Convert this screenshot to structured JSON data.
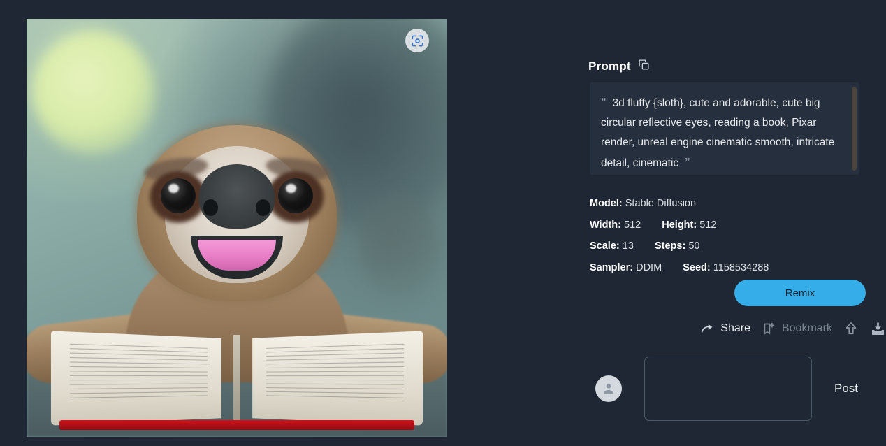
{
  "theme": {
    "background": "#1e2733",
    "panel": "#252f3d",
    "accent": "#34ade9",
    "text": "#e8eaec",
    "muted": "#7e8895"
  },
  "image": {
    "alt_description": "3d fluffy sloth reading a book",
    "scan_button_icon": "scan-viewfinder-icon"
  },
  "prompt": {
    "label": "Prompt",
    "copy_icon": "copy-icon",
    "quote_open": "“",
    "quote_close": "”",
    "text": "3d fluffy {sloth}, cute and adorable, cute big circular reflective eyes, reading a book, Pixar render, unreal engine cinematic smooth, intricate detail, cinematic"
  },
  "metadata": {
    "model_label": "Model:",
    "model_value": "Stable Diffusion",
    "width_label": "Width:",
    "width_value": "512",
    "height_label": "Height:",
    "height_value": "512",
    "scale_label": "Scale:",
    "scale_value": "13",
    "steps_label": "Steps:",
    "steps_value": "50",
    "sampler_label": "Sampler:",
    "sampler_value": "DDIM",
    "seed_label": "Seed:",
    "seed_value": "1158534288"
  },
  "actions": {
    "remix_label": "Remix",
    "share_label": "Share",
    "share_icon": "share-arrow-icon",
    "bookmark_label": "Bookmark",
    "bookmark_icon": "bookmark-add-icon",
    "upvote_icon": "arrow-up-icon",
    "download_icon": "download-icon"
  },
  "comment": {
    "avatar_icon": "user-avatar-icon",
    "input_value": "",
    "input_placeholder": "",
    "post_label": "Post"
  }
}
